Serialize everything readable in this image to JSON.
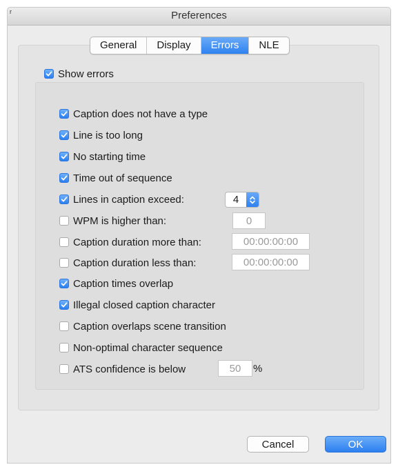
{
  "window": {
    "title": "Preferences",
    "corner_mark": "r"
  },
  "tabs": [
    {
      "label": "General",
      "active": false
    },
    {
      "label": "Display",
      "active": false
    },
    {
      "label": "Errors",
      "active": true
    },
    {
      "label": "NLE",
      "active": false
    }
  ],
  "show_errors": {
    "label": "Show errors",
    "checked": true
  },
  "options": [
    {
      "label": "Caption does not have a type",
      "checked": true
    },
    {
      "label": "Line is too long",
      "checked": true
    },
    {
      "label": "No starting time",
      "checked": true
    },
    {
      "label": "Time out of sequence",
      "checked": true
    },
    {
      "label": "Lines in caption exceed:",
      "checked": true
    },
    {
      "label": "WPM is higher than:",
      "checked": false
    },
    {
      "label": "Caption duration more than:",
      "checked": false
    },
    {
      "label": "Caption duration less than:",
      "checked": false
    },
    {
      "label": "Caption times overlap",
      "checked": true
    },
    {
      "label": "Illegal closed caption character",
      "checked": true
    },
    {
      "label": "Caption overlaps scene transition",
      "checked": false
    },
    {
      "label": "Non-optimal character sequence",
      "checked": false
    },
    {
      "label": "ATS confidence is below",
      "checked": false
    }
  ],
  "fields": {
    "lines_exceed": "4",
    "wpm": "0",
    "duration_more": "00:00:00:00",
    "duration_less": "00:00:00:00",
    "ats_confidence": "50",
    "ats_unit": "%"
  },
  "buttons": {
    "cancel": "Cancel",
    "ok": "OK"
  },
  "colors": {
    "accent": "#2f82f0",
    "window_bg": "#ececec"
  }
}
